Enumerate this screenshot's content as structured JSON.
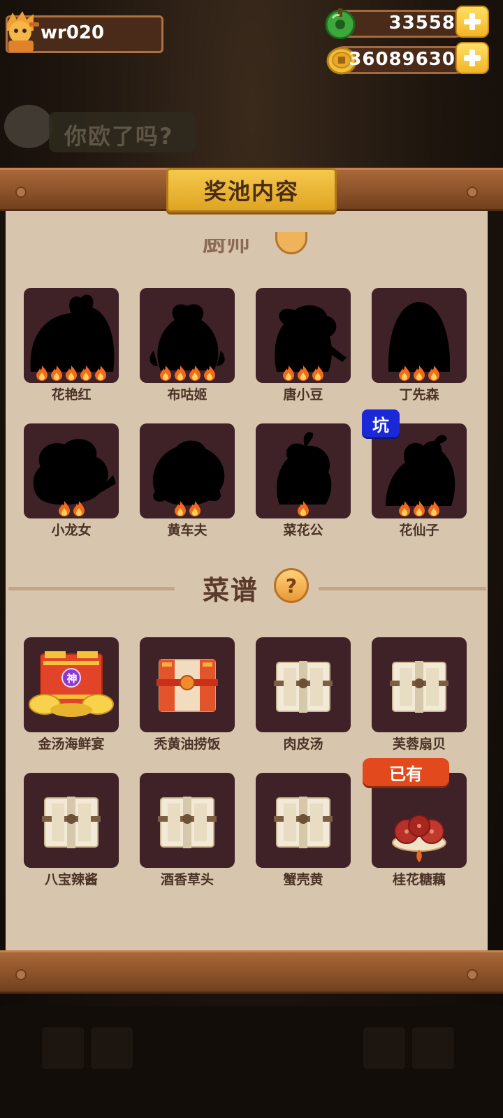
{
  "header": {
    "username": "wr020",
    "jade": {
      "value": "33558",
      "icon": "jade-coin-icon"
    },
    "coins": {
      "value": "36089630",
      "icon": "gold-coin-icon"
    }
  },
  "background": {
    "banner_text": "你欧了吗?"
  },
  "panel": {
    "title": "奖池内容",
    "chefs": [
      {
        "name": "花艳红",
        "stars": 5
      },
      {
        "name": "布咕姬",
        "stars": 4
      },
      {
        "name": "唐小豆",
        "stars": 3
      },
      {
        "name": "丁先森",
        "stars": 3
      },
      {
        "name": "小龙女",
        "stars": 2
      },
      {
        "name": "黄车夫",
        "stars": 2
      },
      {
        "name": "菜花公",
        "stars": 1
      },
      {
        "name": "花仙子",
        "stars": 3,
        "badge": "坑"
      }
    ],
    "recipes_title": "菜谱",
    "help_label": "?",
    "recipes": [
      {
        "name": "金汤海鲜宴",
        "badge_char": "神"
      },
      {
        "name": "秃黄油捞饭"
      },
      {
        "name": "肉皮汤"
      },
      {
        "name": "芙蓉扇贝"
      },
      {
        "name": "八宝辣酱"
      },
      {
        "name": "酒香草头"
      },
      {
        "name": "蟹壳黄"
      },
      {
        "name": "桂花糖藕",
        "badge": "已有"
      }
    ]
  },
  "colors": {
    "panel_bg": "#d8c5ad",
    "tile_bg": "#3f2128",
    "badge_pit": "#1b28d8",
    "badge_owned": "#e24a1d"
  }
}
